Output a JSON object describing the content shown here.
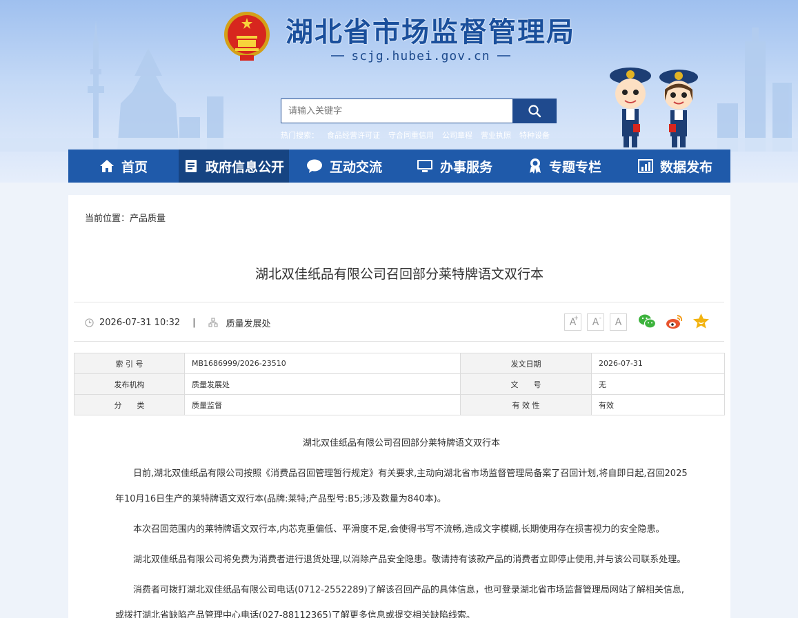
{
  "header": {
    "title": "湖北省市场监督管理局",
    "url": "scjg.hubei.gov.cn",
    "search_placeholder": "请输入关键字",
    "hot_label": "热门搜索：",
    "hot_links": [
      "食品经营许可证",
      "守合同重信用",
      "公司章程",
      "营业执照",
      "特种设备"
    ]
  },
  "nav": {
    "items": [
      {
        "label": "首页",
        "icon": "home-icon"
      },
      {
        "label": "政府信息公开",
        "icon": "document-icon",
        "active": true
      },
      {
        "label": "互动交流",
        "icon": "chat-icon"
      },
      {
        "label": "办事服务",
        "icon": "monitor-icon"
      },
      {
        "label": "专题专栏",
        "icon": "ribbon-icon"
      },
      {
        "label": "数据发布",
        "icon": "bar-chart-icon"
      }
    ]
  },
  "breadcrumb": "当前位置：产品质量",
  "article": {
    "title": "湖北双佳纸品有限公司召回部分莱特牌语文双行本",
    "date": "2026-07-31 10:32",
    "separator": "|",
    "department": "质量发展处"
  },
  "font_buttons": [
    "A",
    "A",
    "A"
  ],
  "info_table": [
    {
      "k1": "索 引 号",
      "v1": "MB1686999/2026-23510",
      "k2": "发文日期",
      "v2": "2026-07-31"
    },
    {
      "k1": "发布机构",
      "v1": "质量发展处",
      "k2": "文　　号",
      "v2": "无"
    },
    {
      "k1": "分　　类",
      "v1": "质量监督",
      "k2": "有 效 性",
      "v2": "有效"
    }
  ],
  "content": {
    "heading": "湖北双佳纸品有限公司召回部分莱特牌语文双行本",
    "paragraphs": [
      "日前,湖北双佳纸品有限公司按照《消费品召回管理暂行规定》有关要求,主动向湖北省市场监督管理局备案了召回计划,将自即日起,召回2025年10月16日生产的莱特牌语文双行本(品牌:莱特;产品型号:B5;涉及数量为840本)。",
      "本次召回范围内的莱特牌语文双行本,内芯克重偏低、平滑度不足,会使得书写不流畅,造成文字模糊,长期使用存在损害视力的安全隐患。",
      "湖北双佳纸品有限公司将免费为消费者进行退货处理,以消除产品安全隐患。敬请持有该款产品的消费者立即停止使用,并与该公司联系处理。",
      "消费者可拨打湖北双佳纸品有限公司电话(0712-2552289)了解该召回产品的具体信息，也可登录湖北省市场监督管理局网站了解相关信息,或拨打湖北省缺陷产品管理中心电话(027-88112365)了解更多信息或提交相关缺陷线索。"
    ]
  },
  "colors": {
    "primary": "#1f5aaa",
    "nav_active": "#164482",
    "title": "#1a4f9c"
  }
}
